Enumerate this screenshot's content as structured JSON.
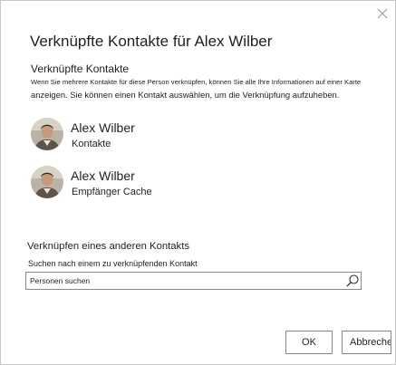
{
  "dialog": {
    "title": "Verknüpfte Kontakte für Alex Wilber",
    "close_icon": "close-icon"
  },
  "linked": {
    "heading": "Verknüpfte Kontakte",
    "description_line1": "Wenn Sie mehrere Kontakte für diese Person verknüpfen, können Sie alle Ihre Informationen auf einer Karte",
    "description_line2": "anzeigen. Sie können einen Kontakt auswählen, um die Verknüpfung aufzuheben.",
    "contacts": [
      {
        "name": "Alex Wilber",
        "source": "Kontakte",
        "avatar_icon": "person-photo"
      },
      {
        "name": "Alex Wilber",
        "source": "Empfänger Cache",
        "avatar_icon": "person-photo"
      }
    ]
  },
  "link_other": {
    "heading": "Verknüpfen eines anderen Kontakts",
    "search_label": "Suchen nach einem zu verknüpfenden Kontakt",
    "search_placeholder": "Personen suchen",
    "search_value": "",
    "search_icon": "search-icon"
  },
  "buttons": {
    "ok": "OK",
    "cancel": "Abbrechen"
  }
}
